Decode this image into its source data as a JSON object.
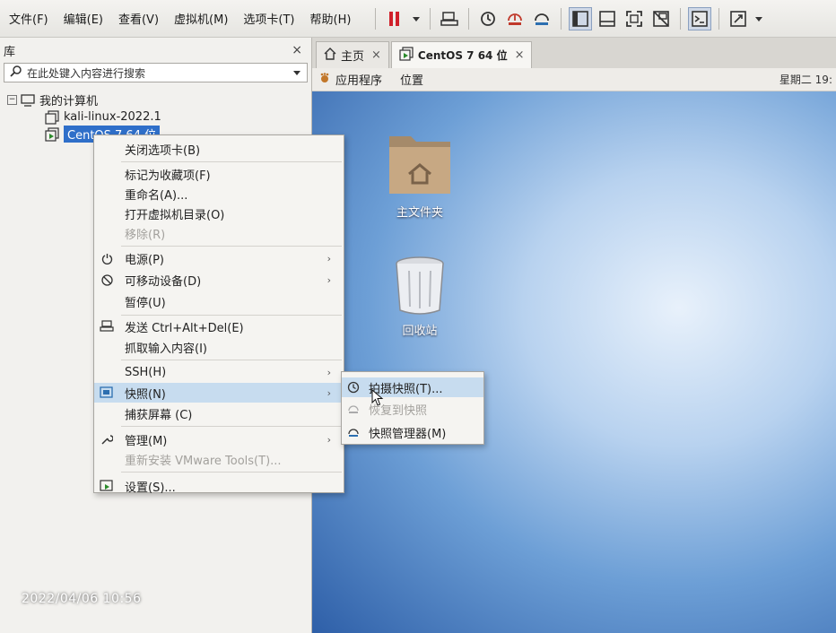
{
  "menubar": {
    "items": [
      "文件(F)",
      "编辑(E)",
      "查看(V)",
      "虚拟机(M)",
      "选项卡(T)",
      "帮助(H)"
    ]
  },
  "toolbar": {
    "icons": [
      "pause-icon",
      "dropdown-icon",
      "send-ctrl-alt-del-icon",
      "snapshot-icon",
      "revert-snapshot-icon",
      "snapshot-manager-icon",
      "sidebar-view-icon",
      "tab-view-icon",
      "fullscreen-icon",
      "unity-icon",
      "console-icon",
      "stretch-icon"
    ]
  },
  "library": {
    "title": "库",
    "close": "×",
    "search_placeholder": "在此处键入内容进行搜索",
    "root": "我的计算机",
    "vms": [
      "kali-linux-2022.1",
      "CentOS 7 64 位"
    ]
  },
  "tabs": [
    {
      "label": "主页",
      "close": "×"
    },
    {
      "label": "CentOS 7 64 位",
      "close": "×"
    }
  ],
  "guest_topbar": {
    "apps": "应用程序",
    "places": "位置",
    "clock": "星期二 19:"
  },
  "desktop": {
    "home_folder": "主文件夹",
    "trash": "回收站"
  },
  "context_menu": {
    "close_tab": "关闭选项卡(B)",
    "favorite": "标记为收藏项(F)",
    "rename": "重命名(A)...",
    "open_dir": "打开虚拟机目录(O)",
    "remove": "移除(R)",
    "power": "电源(P)",
    "removable": "可移动设备(D)",
    "pause": "暂停(U)",
    "send_cad": "发送 Ctrl+Alt+Del(E)",
    "grab_input": "抓取输入内容(I)",
    "ssh": "SSH(H)",
    "snapshot": "快照(N)",
    "capture_screen": "捕获屏幕 (C)",
    "manage": "管理(M)",
    "reinstall_tools": "重新安装 VMware Tools(T)...",
    "settings": "设置(S)..."
  },
  "snapshot_submenu": {
    "take": "拍摄快照(T)...",
    "revert": "恢复到快照",
    "manager": "快照管理器(M)"
  },
  "photo_timestamp": "2022/04/06 10:56"
}
